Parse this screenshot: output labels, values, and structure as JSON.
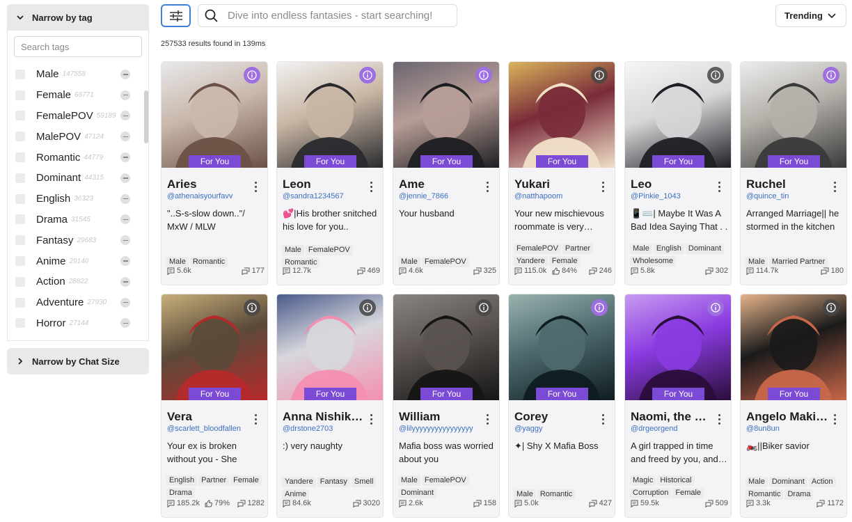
{
  "sidebar": {
    "tag_panel_title": "Narrow by tag",
    "tag_search_placeholder": "Search tags",
    "tags": [
      {
        "name": "Male",
        "count": "147558"
      },
      {
        "name": "Female",
        "count": "66771"
      },
      {
        "name": "FemalePOV",
        "count": "59189"
      },
      {
        "name": "MalePOV",
        "count": "47124"
      },
      {
        "name": "Romantic",
        "count": "44779"
      },
      {
        "name": "Dominant",
        "count": "44315"
      },
      {
        "name": "English",
        "count": "36323"
      },
      {
        "name": "Drama",
        "count": "31545"
      },
      {
        "name": "Fantasy",
        "count": "29683"
      },
      {
        "name": "Anime",
        "count": "29140"
      },
      {
        "name": "Action",
        "count": "28822"
      },
      {
        "name": "Adventure",
        "count": "27930"
      },
      {
        "name": "Horror",
        "count": "27144"
      }
    ],
    "chat_size_panel_title": "Narrow by Chat Size"
  },
  "topbar": {
    "search_placeholder": "Dive into endless fantasies - start searching!",
    "sort_label": "Trending",
    "results_text": "257533 results found in 139ms"
  },
  "badge_label": "For You",
  "colors": {
    "accent": "#7b4bd6",
    "handle": "#3c6fc0",
    "filter_border": "#3f7fd6"
  },
  "cards": [
    {
      "name": "Aries",
      "handle": "@athenaisyourfavv",
      "desc": "\"..S-s-slow down..\"/ MxW / MLW",
      "tags": [
        "Male",
        "Romantic"
      ],
      "messages": "5.6k",
      "likes": "",
      "count": "177",
      "info_style": "purple"
    },
    {
      "name": "Leon",
      "handle": "@sandra1234567",
      "desc": "💕|His brother snitched his love for you..",
      "tags": [
        "Male",
        "FemalePOV",
        "Romantic"
      ],
      "messages": "12.7k",
      "likes": "",
      "count": "469",
      "info_style": "purple"
    },
    {
      "name": "Ame",
      "handle": "@jennie_7866",
      "desc": "Your husband",
      "tags": [
        "Male",
        "FemalePOV"
      ],
      "messages": "4.6k",
      "likes": "",
      "count": "325",
      "info_style": "purple"
    },
    {
      "name": "Yukari",
      "handle": "@natthapoom",
      "desc": "Your new mischievous roommate is very…",
      "tags": [
        "FemalePOV",
        "Partner",
        "Yandere",
        "Female"
      ],
      "messages": "115.0k",
      "likes": "84%",
      "count": "246",
      "info_style": "dark"
    },
    {
      "name": "Leo",
      "handle": "@Pinkie_1043",
      "desc": "📱⌨️| Maybe It Was A Bad Idea Saying That . .",
      "tags": [
        "Male",
        "English",
        "Dominant",
        "Wholesome"
      ],
      "messages": "5.8k",
      "likes": "",
      "count": "302",
      "info_style": "dark"
    },
    {
      "name": "Ruchel",
      "handle": "@quince_tin",
      "desc": "Arranged Marriage|| he stormed in the kitchen \"Bedroom. Now.\" He…",
      "tags": [
        "Male",
        "Married Partner"
      ],
      "messages": "114.7k",
      "likes": "",
      "count": "180",
      "info_style": "purple"
    },
    {
      "name": "Vera",
      "handle": "@scarlett_bloodfallen",
      "desc": "Your ex is broken without you - She took…",
      "tags": [
        "English",
        "Partner",
        "Female",
        "Drama"
      ],
      "messages": "185.2k",
      "likes": "79%",
      "count": "1282",
      "info_style": "dark"
    },
    {
      "name": "Anna Nishikinomiya",
      "handle": "@drstone2703",
      "desc": ":) very naughty",
      "tags": [
        "Yandere",
        "Fantasy",
        "Smell",
        "Anime"
      ],
      "messages": "84.6k",
      "likes": "",
      "count": "3020",
      "info_style": "dark"
    },
    {
      "name": "William",
      "handle": "@lilyyyyyyyyyyyyyyyy",
      "desc": "Mafia boss was worried about you",
      "tags": [
        "Male",
        "FemalePOV",
        "Dominant"
      ],
      "messages": "2.6k",
      "likes": "",
      "count": "158",
      "info_style": "dark"
    },
    {
      "name": "Corey",
      "handle": "@yaggy",
      "desc": "✦| Shy X Mafia Boss",
      "tags": [
        "Male",
        "Romantic"
      ],
      "messages": "5.0k",
      "likes": "",
      "count": "427",
      "info_style": "purple"
    },
    {
      "name": "Naomi, the Nightmare",
      "handle": "@drgeorgend",
      "desc": "A girl trapped in time and freed by you, and…",
      "tags": [
        "Magic",
        "Historical",
        "Corruption",
        "Female"
      ],
      "messages": "59.5k",
      "likes": "",
      "count": "509",
      "info_style": "purple"
    },
    {
      "name": "Angelo Makishima",
      "handle": "@8un8un",
      "desc": "🏍️||Biker savior",
      "tags": [
        "Male",
        "Dominant",
        "Action",
        "Romantic",
        "Drama"
      ],
      "messages": "3.3k",
      "likes": "",
      "count": "1172",
      "info_style": "dark"
    }
  ]
}
